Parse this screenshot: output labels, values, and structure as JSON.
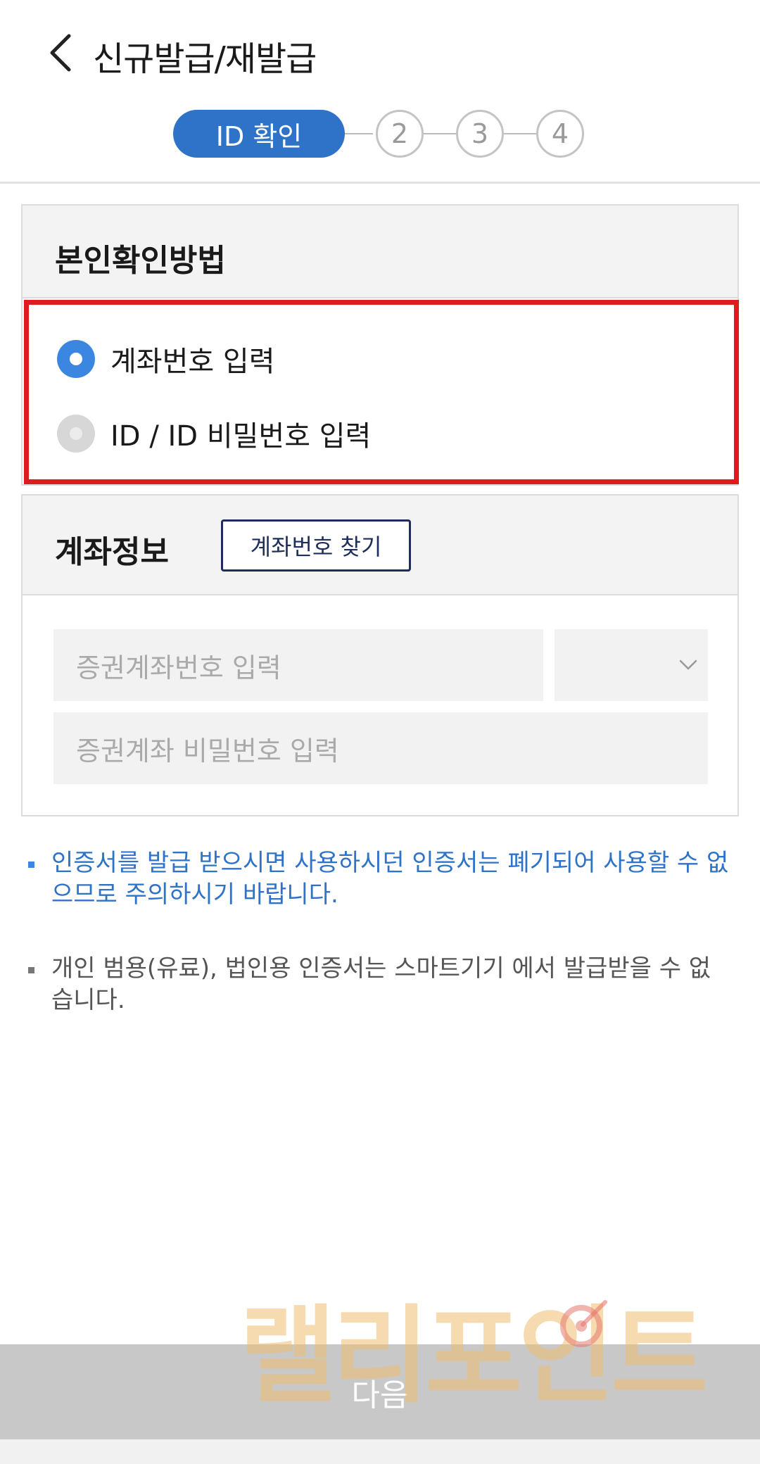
{
  "header": {
    "title": "신규발급/재발급"
  },
  "stepper": {
    "active_label": "ID 확인",
    "steps": [
      "2",
      "3",
      "4"
    ]
  },
  "identity_method": {
    "title": "본인확인방법",
    "options": [
      {
        "label": "계좌번호 입력",
        "selected": true
      },
      {
        "label": "ID / ID 비밀번호 입력",
        "selected": false
      }
    ]
  },
  "account_info": {
    "title": "계좌정보",
    "find_button": "계좌번호 찾기",
    "account_placeholder": "증권계좌번호 입력",
    "password_placeholder": "증권계좌 비밀번호 입력"
  },
  "notices": [
    "인증서를 발급 받으시면 사용하시던 인증서는 폐기되어 사용할 수 없으므로 주의하시기 바랍니다.",
    "개인 범용(유료), 법인용 인증서는 스마트기기 에서 발급받을 수 없습니다."
  ],
  "next_button": "다음",
  "watermark": "랠리포인트",
  "colors": {
    "primary": "#2f73c8",
    "radio_selected": "#3b86e0",
    "highlight": "#e01b1b",
    "find_button_border": "#1e2e5c"
  }
}
